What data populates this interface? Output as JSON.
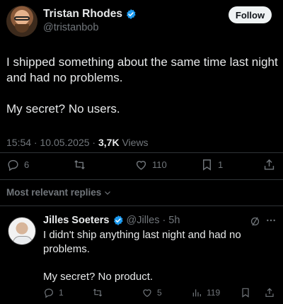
{
  "post": {
    "author_name": "Tristan Rhodes",
    "handle": "@tristanbob",
    "follow_label": "Follow",
    "text_line1": "I shipped something about the same time last night and had no problems.",
    "text_line2": "My secret?  No users.",
    "timestamp": "15:54 · 10.05.2025 · ",
    "views_count": "3,7K",
    "views_label": " Views",
    "actions": {
      "replies": "6",
      "retweets": "",
      "likes": "110",
      "bookmarks": "1"
    }
  },
  "sort_label": "Most relevant replies",
  "reply": {
    "author_name": "Jilles Soeters",
    "handle": "@Jilles",
    "time": "· 5h",
    "text_line1": "I didn't ship anything last night and had no problems.",
    "text_line2": "My secret? No product.",
    "actions": {
      "replies": "1",
      "retweets": "",
      "likes": "5",
      "views": "119"
    }
  },
  "colors": {
    "background": "#000000",
    "text": "#e7e9ea",
    "muted": "#71767b",
    "verified": "#1d9bf0"
  }
}
